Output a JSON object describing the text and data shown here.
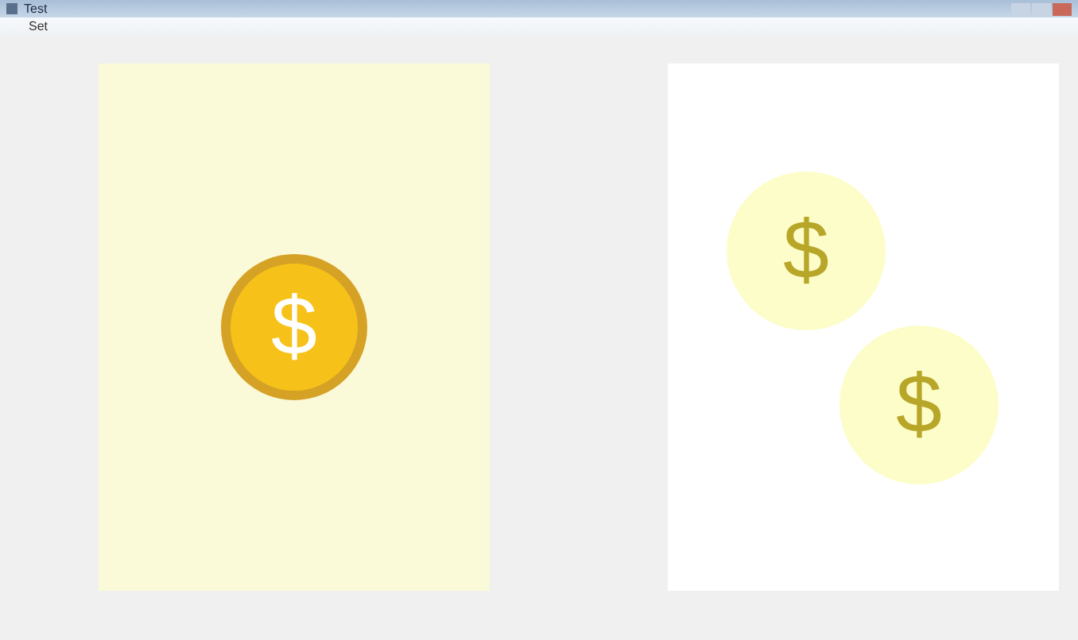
{
  "window": {
    "title": "Test"
  },
  "menu": [
    "Set"
  ],
  "panels": [
    {
      "kind": "tinted",
      "coins": [
        {
          "symbol": "$",
          "faded": false
        }
      ]
    },
    {
      "kind": "white",
      "coins": [
        {
          "symbol": "$",
          "faded": true
        },
        {
          "symbol": "$",
          "faded": true
        }
      ]
    }
  ]
}
